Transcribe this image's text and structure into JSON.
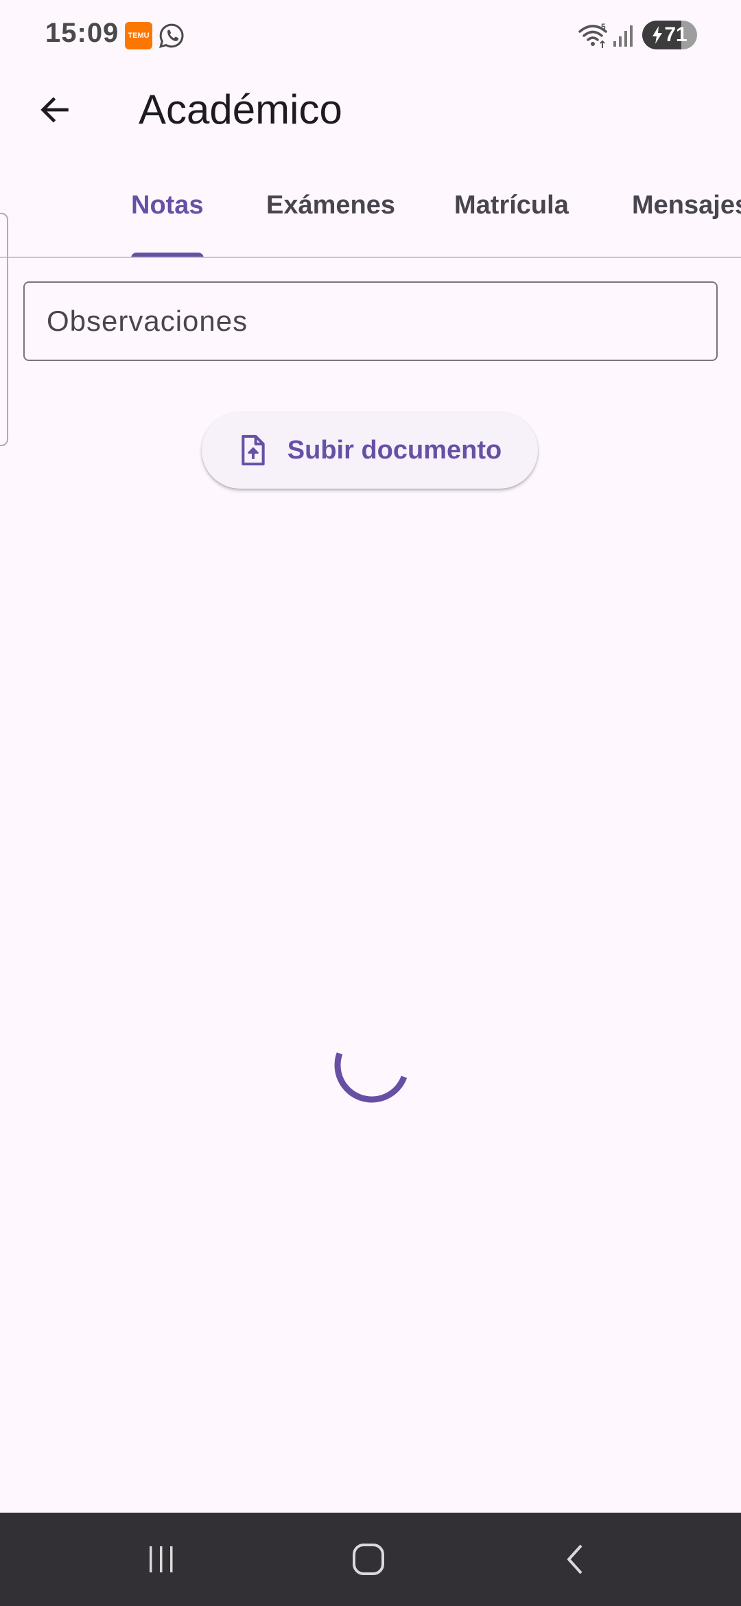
{
  "status_bar": {
    "time": "15:09",
    "temu_label": "TEMU",
    "battery_level": "71",
    "wifi_badge": "5"
  },
  "app_bar": {
    "title": "Académico"
  },
  "tabs": [
    {
      "label": "Notas",
      "active": true
    },
    {
      "label": "Exámenes",
      "active": false
    },
    {
      "label": "Matrícula",
      "active": false
    },
    {
      "label": "Mensajes",
      "active": false
    }
  ],
  "form": {
    "observations_placeholder": "Observaciones",
    "upload_label": "Subir documento"
  },
  "colors": {
    "primary": "#6750A4",
    "background": "#FEF7FD",
    "nav_bar": "#323034"
  },
  "icons": {
    "back": "arrow-left-icon",
    "upload": "file-upload-icon",
    "loading": "progress-spinner"
  }
}
